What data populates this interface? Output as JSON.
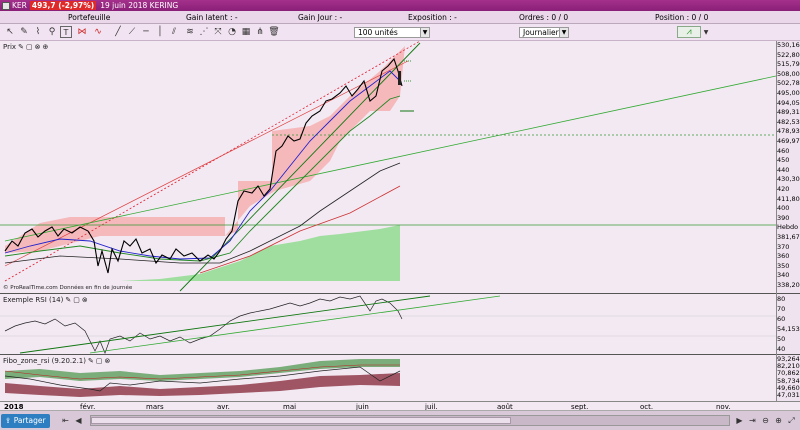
{
  "titlebar": {
    "symbol": "KER",
    "price_change": "493,7 (-2,97%)",
    "date_name": "19 juin 2018 KERING"
  },
  "summary": {
    "portefeuille": "Portefeuille",
    "gain_latent": "Gain latent : -",
    "gain_jour": "Gain Jour : -",
    "exposition": "Exposition : -",
    "ordres": "Ordres : 0 / 0",
    "position": "Position : 0 / 0"
  },
  "toolbar": {
    "quantity": "100 unités",
    "period": "Journalier"
  },
  "panels": {
    "price": "Prix",
    "rsi": "Exemple RSI (14)",
    "fibo": "Fibo_zone_rsi (9.20.2.1)",
    "source": "© ProRealTime.com Données en fin de journée"
  },
  "price_axis": [
    "530,16",
    "522,80",
    "515,79",
    "508,00",
    "502,78",
    "495,00",
    "494,05",
    "489,31",
    "482,53",
    "478,93",
    "469,97",
    "460",
    "450",
    "440",
    "430,30",
    "420",
    "411,80",
    "400",
    "390",
    "Hebdo",
    "381,67",
    "370",
    "360",
    "350",
    "340",
    "338,20"
  ],
  "rsi_axis": [
    "80",
    "70",
    "60",
    "54,153",
    "50",
    "40"
  ],
  "fibo_axis": [
    "93,264",
    "82,210",
    "70,862",
    "58,734",
    "49,660",
    "47,031"
  ],
  "months": [
    "2018",
    "févr.",
    "mars",
    "avr.",
    "mai",
    "juin",
    "juil.",
    "août",
    "sept.",
    "oct.",
    "nov."
  ],
  "bottombar": {
    "share": "Partager"
  },
  "colors": {
    "accent": "#a4318c",
    "green_band": "#7fd37f",
    "red_band": "#f4a3a3",
    "price_line": "#000000",
    "ma_blue": "#2222cc"
  }
}
